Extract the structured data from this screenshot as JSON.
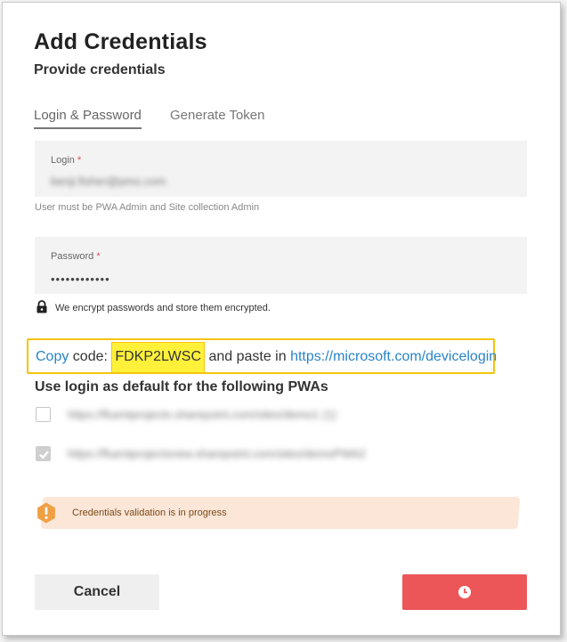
{
  "dialog": {
    "title": "Add Credentials",
    "subtitle": "Provide credentials"
  },
  "tabs": [
    {
      "label": "Login & Password",
      "active": true
    },
    {
      "label": "Generate Token",
      "active": false
    }
  ],
  "login": {
    "label": "Login",
    "required_mark": "*",
    "value": "benji.fisher@pmo.com",
    "hint": "User must be PWA Admin and Site collection Admin"
  },
  "password": {
    "label": "Password",
    "required_mark": "*",
    "value": "••••••••••••"
  },
  "encrypt_note": "We encrypt passwords and store them encrypted.",
  "device_code": {
    "copy_link": "Copy",
    "code_label": " code: ",
    "code": "FDKP2LWSC",
    "middle_text": " and paste in ",
    "url": "https://microsoft.com/devicelogin",
    "highlight_color": "#fff13a",
    "border_color": "#f4c40d"
  },
  "pwa": {
    "heading": "Use login as default for the following PWAs",
    "items": [
      {
        "url": "https://fluentprojects.sharepoint.com/sites/demo1 (1)",
        "checked": false
      },
      {
        "url": "https://fluentprojectsnew.sharepoint.com/sites/demoPWA2",
        "checked": true
      }
    ]
  },
  "alert": {
    "message": "Credentials validation is in progress",
    "icon": "exclamation-icon",
    "color": "#f0a044"
  },
  "buttons": {
    "cancel": "Cancel",
    "submit_icon": "clock-icon",
    "submit_color": "#ec5658"
  }
}
